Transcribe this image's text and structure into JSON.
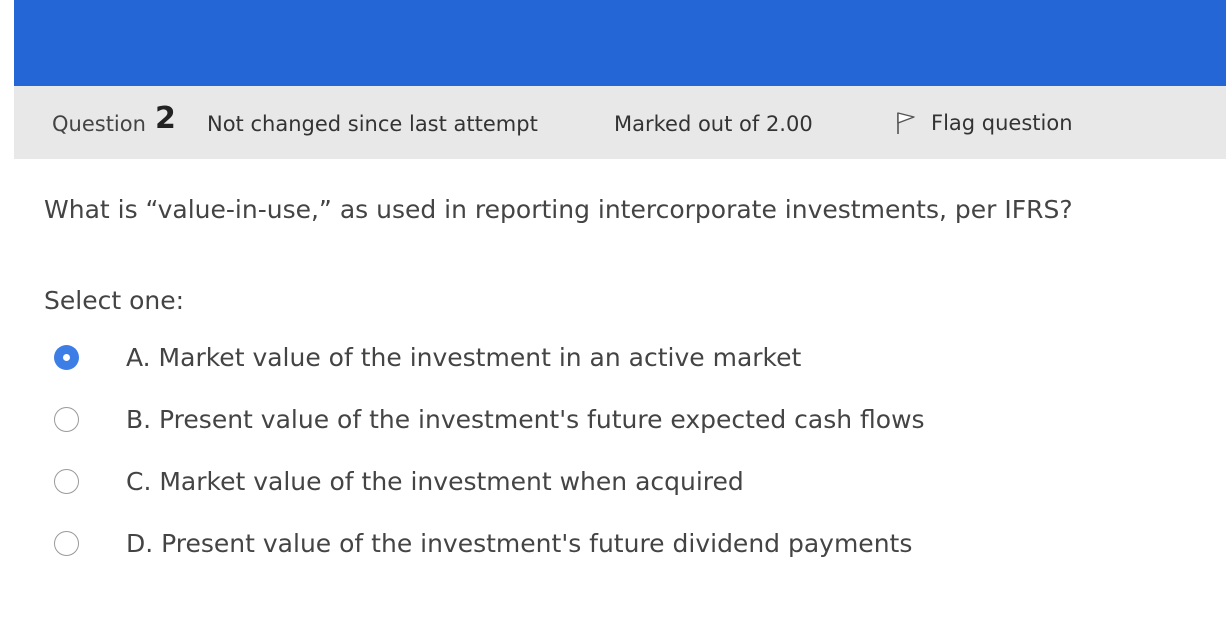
{
  "header": {
    "question_label": "Question",
    "question_number": "2",
    "status": "Not changed since last attempt",
    "marks": "Marked out of 2.00",
    "flag_label": "Flag question"
  },
  "question": {
    "text": "What is “value-in-use,” as used in reporting intercorporate investments, per IFRS?",
    "select_prompt": "Select one:",
    "options": [
      {
        "label": "A. Market value of the investment in an active market",
        "selected": true
      },
      {
        "label": "B. Present value of the investment's future expected cash flows",
        "selected": false
      },
      {
        "label": "C. Market value of the investment when acquired",
        "selected": false
      },
      {
        "label": "D. Present value of the investment's future dividend payments",
        "selected": false
      }
    ]
  },
  "colors": {
    "banner": "#2566d6",
    "info_bar": "#e8e8e8",
    "radio_selected": "#3d7ee6"
  },
  "icons": {
    "flag": "flag-icon"
  }
}
